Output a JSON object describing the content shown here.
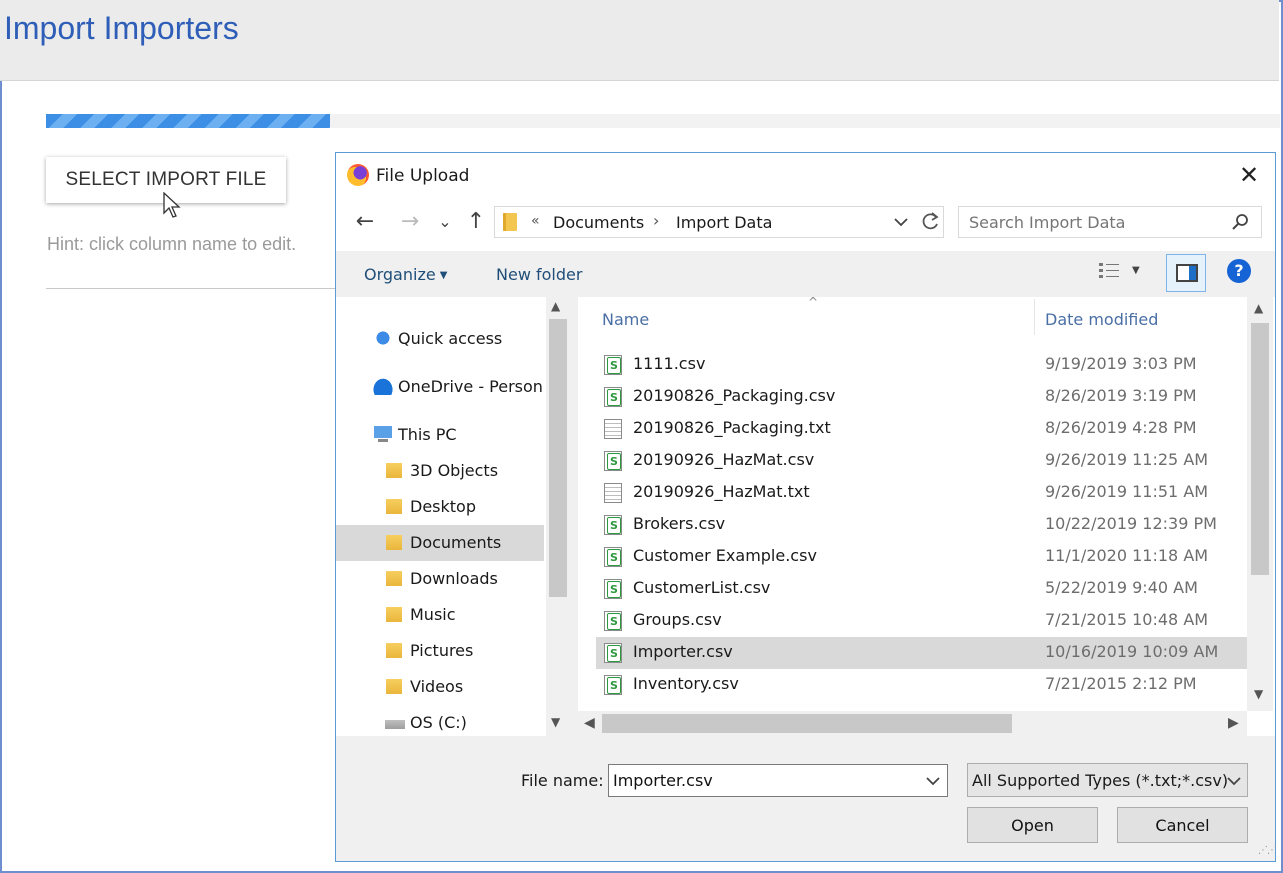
{
  "app": {
    "title": "Import Importers",
    "progress_fraction": 0.23,
    "select_button": "SELECT IMPORT FILE",
    "hint": "Hint: click column name to edit."
  },
  "dialog": {
    "title": "File Upload",
    "close_glyph": "✕",
    "nav": {
      "back": "←",
      "forward": "→",
      "recent": "⌄",
      "up": "↑"
    },
    "address": {
      "overflow": "«",
      "crumbs": [
        "Documents",
        "Import Data"
      ],
      "separator": "›"
    },
    "search": {
      "placeholder": "Search Import Data"
    },
    "toolbar": {
      "organize": "Organize",
      "new_folder": "New folder",
      "help": "?"
    },
    "nav_pane": {
      "items": [
        {
          "label": "Quick access",
          "icon": "star-icon"
        },
        {
          "label": "OneDrive - Person",
          "icon": "cloud-icon"
        },
        {
          "label": "This PC",
          "icon": "computer-icon"
        },
        {
          "label": "3D Objects",
          "icon": "folder-3d-icon"
        },
        {
          "label": "Desktop",
          "icon": "folder-desktop-icon"
        },
        {
          "label": "Documents",
          "icon": "folder-documents-icon",
          "selected": true
        },
        {
          "label": "Downloads",
          "icon": "folder-downloads-icon"
        },
        {
          "label": "Music",
          "icon": "folder-music-icon"
        },
        {
          "label": "Pictures",
          "icon": "folder-pictures-icon"
        },
        {
          "label": "Videos",
          "icon": "folder-videos-icon"
        },
        {
          "label": "OS (C:)",
          "icon": "drive-icon"
        }
      ]
    },
    "columns": {
      "name": "Name",
      "date": "Date modified"
    },
    "files": [
      {
        "name": "1111.csv",
        "date": "9/19/2019 3:03 PM",
        "type": "csv"
      },
      {
        "name": "20190826_Packaging.csv",
        "date": "8/26/2019 3:19 PM",
        "type": "csv"
      },
      {
        "name": "20190826_Packaging.txt",
        "date": "8/26/2019 4:28 PM",
        "type": "txt"
      },
      {
        "name": "20190926_HazMat.csv",
        "date": "9/26/2019 11:25 AM",
        "type": "csv"
      },
      {
        "name": "20190926_HazMat.txt",
        "date": "9/26/2019 11:51 AM",
        "type": "txt"
      },
      {
        "name": "Brokers.csv",
        "date": "10/22/2019 12:39 PM",
        "type": "csv"
      },
      {
        "name": "Customer Example.csv",
        "date": "11/1/2020 11:18 AM",
        "type": "csv"
      },
      {
        "name": "CustomerList.csv",
        "date": "5/22/2019 9:40 AM",
        "type": "csv"
      },
      {
        "name": "Groups.csv",
        "date": "7/21/2015 10:48 AM",
        "type": "csv"
      },
      {
        "name": "Importer.csv",
        "date": "10/16/2019 10:09 AM",
        "type": "csv",
        "selected": true
      },
      {
        "name": "Inventory.csv",
        "date": "7/21/2015 2:12 PM",
        "type": "csv"
      }
    ],
    "file_name": {
      "label": "File name:",
      "value": "Importer.csv"
    },
    "file_type": "All Supported Types (*.txt;*.csv)",
    "buttons": {
      "open": "Open",
      "cancel": "Cancel"
    }
  }
}
